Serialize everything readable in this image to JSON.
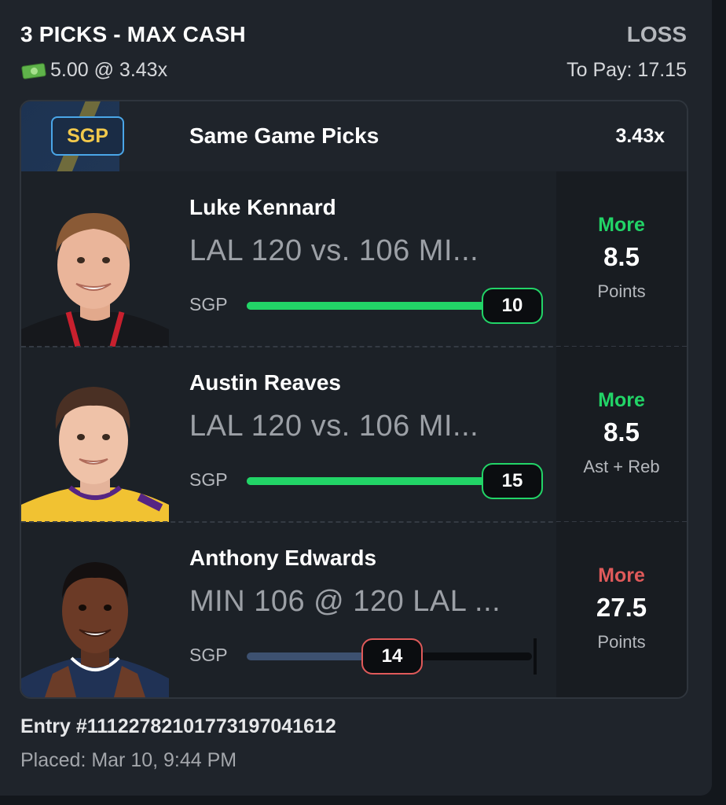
{
  "card": {
    "title": "3 PICKS - MAX CASH",
    "result": "LOSS",
    "stake": "5.00 @ 3.43x",
    "to_pay": "To Pay: 17.15"
  },
  "header": {
    "badge": "SGP",
    "title": "Same Game Picks",
    "multiplier": "3.43x"
  },
  "picks": [
    {
      "player": "Luke Kennard",
      "matchup": "LAL 120 vs. 106 MI...",
      "bar_label": "SGP",
      "current": "10",
      "progress": 1.0,
      "hit": true,
      "direction": "More",
      "line": "8.5",
      "stat": "Points"
    },
    {
      "player": "Austin Reaves",
      "matchup": "LAL 120 vs. 106 MI...",
      "bar_label": "SGP",
      "current": "15",
      "progress": 1.0,
      "hit": true,
      "direction": "More",
      "line": "8.5",
      "stat": "Ast + Reb"
    },
    {
      "player": "Anthony Edwards",
      "matchup": "MIN 106 @ 120 LAL ...",
      "bar_label": "SGP",
      "current": "14",
      "progress": 0.51,
      "hit": false,
      "direction": "More",
      "line": "27.5",
      "stat": "Points"
    }
  ],
  "footer": {
    "entry": "Entry #111227821017731970416​12",
    "placed": "Placed: Mar 10, 9:44 PM"
  },
  "colors": {
    "win": "#22d467",
    "loss": "#e05a5a",
    "track_pending": "#3d5170",
    "track_empty": "#0b0d10"
  },
  "icons": {
    "stake": "money-icon"
  }
}
